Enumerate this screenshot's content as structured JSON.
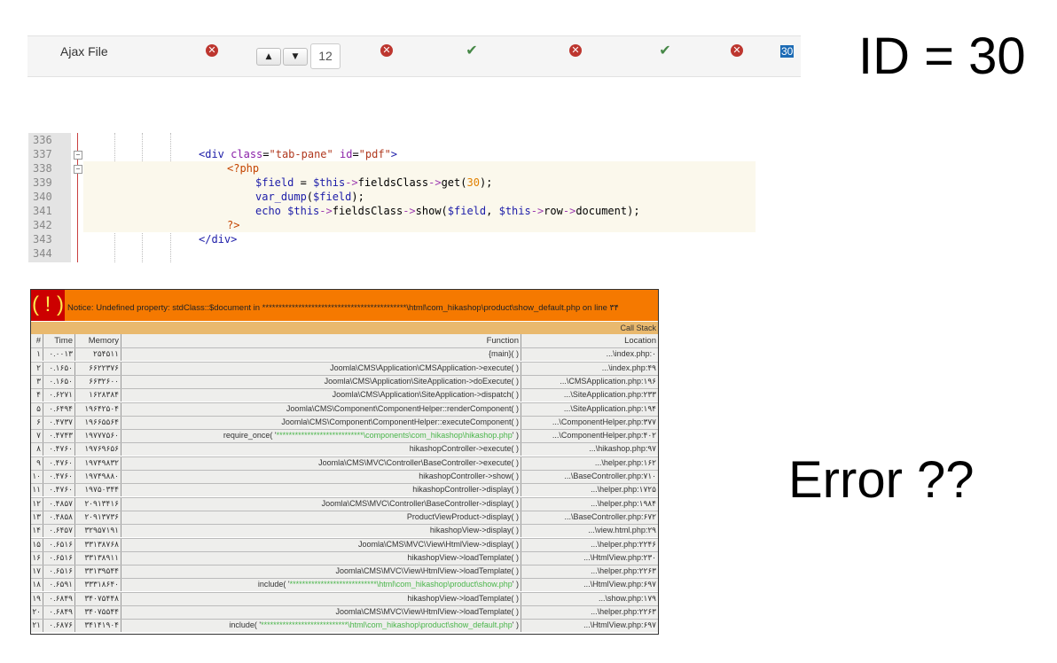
{
  "field_row": {
    "name": "Ajax File",
    "order_value": "12",
    "id_value": "30",
    "statuses": [
      "error",
      "error",
      "ok",
      "error",
      "ok",
      "error"
    ]
  },
  "big_labels": {
    "id_label": "ID = 30",
    "error_label": "Error ??"
  },
  "code": {
    "lines": [
      {
        "num": "336"
      },
      {
        "num": "337"
      },
      {
        "num": "338"
      },
      {
        "num": "339"
      },
      {
        "num": "340"
      },
      {
        "num": "341"
      },
      {
        "num": "342"
      },
      {
        "num": "343"
      },
      {
        "num": "344"
      }
    ]
  },
  "error": {
    "icon": "( ! )",
    "message": "Notice: Undefined property: stdClass::$document in ********************************************\\html\\com_hikashop\\product\\show_default.php on line ٣۴",
    "callstack_title": "Call Stack",
    "headers": [
      "#",
      "Time",
      "Memory",
      "Function",
      "Location"
    ],
    "rows": [
      [
        "١",
        "٠.٠٠١٣",
        "٢۵۴۵١١",
        "{main}( )",
        "...\\index.php:٠"
      ],
      [
        "٢",
        "٠.١۶۵٠",
        "۶۶٢٢٣٧۶",
        "Joomla\\CMS\\Application\\CMSApplication->execute( )",
        "...\\index.php:۴٩"
      ],
      [
        "٣",
        "٠.١۶۵٠",
        "۶۶٣٢۶٠٠",
        "Joomla\\CMS\\Application\\SiteApplication->doExecute( )",
        "...\\CMSApplication.php:١٩۶"
      ],
      [
        "۴",
        "٠.۶٢٧١",
        "١۶٢٨٣٨۴",
        "Joomla\\CMS\\Application\\SiteApplication->dispatch( )",
        "...\\SiteApplication.php:٢٣٣"
      ],
      [
        "۵",
        "٠.۶۴٩۴",
        "١٩۶۴٢۵٠۴",
        "Joomla\\CMS\\Component\\ComponentHelper::renderComponent( )",
        "...\\SiteApplication.php:١٩۴"
      ],
      [
        "۶",
        "٠.۴٧٣٧",
        "١٩۶۶۵۵۶۴",
        "Joomla\\CMS\\Component\\ComponentHelper::executeComponent( )",
        "...\\ComponentHelper.php:٣٧٧"
      ],
      [
        "٧",
        "٠.۴٧۴٣",
        "١٩٧٧٧۵۶٠",
        "require_once( '****************************\\components\\com_hikashop\\hikashop.php' )",
        "...\\ComponentHelper.php:۴٠٢"
      ],
      [
        "٨",
        "٠.۴٧۶٠",
        "١٩٧۶٩۶۵۶",
        "hikashopController->execute( )",
        "...\\hikashop.php:٩٧"
      ],
      [
        "٩",
        "٠.۴٧۶٠",
        "١٩٧۴٩٨٣٢",
        "Joomla\\CMS\\MVC\\Controller\\BaseController->execute( )",
        "...\\helper.php:١۶٢"
      ],
      [
        "١٠",
        "٠.۴٧۶٠",
        "١٩٧۴٩٨٨٠",
        "hikashopController->show( )",
        "...\\BaseController.php:٧١٠"
      ],
      [
        "١١",
        "٠.۴٧۶٠",
        "١٩٧۵٠٣۴۴",
        "hikashopController->display( )",
        "...\\helper.php:١٧٢۵"
      ],
      [
        "١٢",
        "٠.۴٨۵٧",
        "٢٠٩١٣۴١۶",
        "Joomla\\CMS\\MVC\\Controller\\BaseController->display( )",
        "...\\helper.php:١٩٨۴"
      ],
      [
        "١٣",
        "٠.۴٨۵٨",
        "٢٠٩١٣٧٣۶",
        "ProductViewProduct->display( )",
        "...\\BaseController.php:۶٧٢"
      ],
      [
        "١۴",
        "٠.۶۴۵٧",
        "٣٢٩۵٧١٩١",
        "hikashopView->display( )",
        "...\\view.html.php:٢٩"
      ],
      [
        "١۵",
        "٠.۶۵١۶",
        "٣٣١٣٨٧۶٨",
        "Joomla\\CMS\\MVC\\View\\HtmlView->display( )",
        "...\\helper.php:٢٢۴۶"
      ],
      [
        "١۶",
        "٠.۶۵١۶",
        "٣٣١٣٨٩١١",
        "hikashopView->loadTemplate( )",
        "...\\HtmlView.php:٢٣٠"
      ],
      [
        "١٧",
        "٠.۶۵١۶",
        "٣٣١٣٩۵۴۴",
        "Joomla\\CMS\\MVC\\View\\HtmlView->loadTemplate( )",
        "...\\helper.php:٢٢۶٣"
      ],
      [
        "١٨",
        "٠.۶۵٩١",
        "٣٣٣١٨۶۴٠",
        "include( '****************************\\html\\com_hikashop\\product\\show.php' )",
        "...\\HtmlView.php:۶٩٧"
      ],
      [
        "١٩",
        "٠.۶٨۴٩",
        "٣۴٠٧۵۴۴٨",
        "hikashopView->loadTemplate( )",
        "...\\show.php:١٧٩"
      ],
      [
        "٢٠",
        "٠.۶٨۴٩",
        "٣۴٠٧۵۵۴۴",
        "Joomla\\CMS\\MVC\\View\\HtmlView->loadTemplate( )",
        "...\\helper.php:٢٢۶٣"
      ],
      [
        "٢١",
        "٠.۶٨٧۶",
        "٣۴١۴١٩٠۴",
        "include( '****************************\\html\\com_hikashop\\product\\show_default.php' )",
        "...\\HtmlView.php:۶٩٧"
      ]
    ]
  }
}
